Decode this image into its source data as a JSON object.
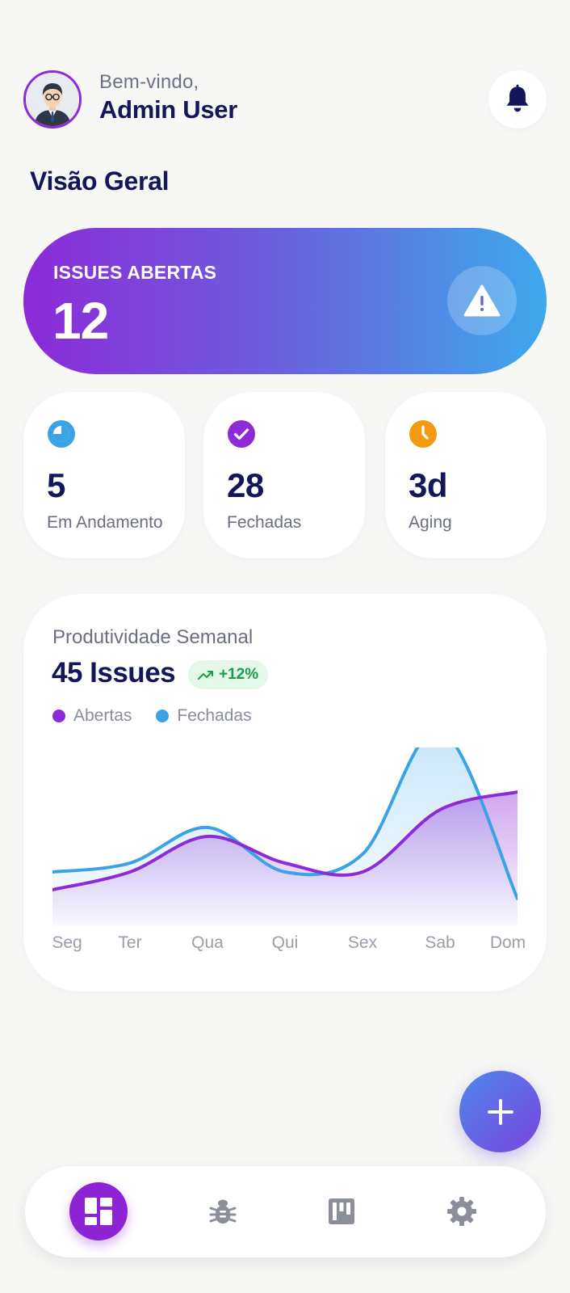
{
  "header": {
    "greeting": "Bem-vindo,",
    "user_name": "Admin User",
    "avatar_icon": "user-avatar",
    "notification_icon": "bell-icon"
  },
  "overview": {
    "title": "Visão Geral",
    "hero": {
      "label": "ISSUES ABERTAS",
      "value": "12",
      "icon": "warning-icon"
    },
    "stats": [
      {
        "value": "5",
        "label": "Em Andamento",
        "icon": "progress-icon",
        "color": "#3aa3e6"
      },
      {
        "value": "28",
        "label": "Fechadas",
        "icon": "check-circle-icon",
        "color": "#8e2bd9"
      },
      {
        "value": "3d",
        "label": "Aging",
        "icon": "clock-icon",
        "color": "#f39a12"
      }
    ]
  },
  "productivity": {
    "subtitle": "Produtividade Semanal",
    "total": "45 Issues",
    "trend": "+12%",
    "trend_icon": "trending-up-icon",
    "legend": [
      {
        "name": "Abertas",
        "color": "#8e2bd9"
      },
      {
        "name": "Fechadas",
        "color": "#3aa3e6"
      }
    ]
  },
  "chart_data": {
    "type": "area",
    "categories": [
      "Seg",
      "Ter",
      "Qua",
      "Qui",
      "Sex",
      "Sab",
      "Dom"
    ],
    "series": [
      {
        "name": "Abertas",
        "color": "#8e2bd9",
        "values": [
          4,
          6,
          10,
          7,
          6,
          13,
          15
        ]
      },
      {
        "name": "Fechadas",
        "color": "#3aa3e6",
        "values": [
          6,
          7,
          11,
          6,
          8,
          22,
          3
        ]
      }
    ],
    "ylim": [
      0,
      20
    ],
    "grid": false,
    "legend": "top-left"
  },
  "fab": {
    "icon": "plus-icon"
  },
  "nav": [
    {
      "icon": "dashboard-icon",
      "active": true
    },
    {
      "icon": "bug-icon",
      "active": false
    },
    {
      "icon": "board-icon",
      "active": false
    },
    {
      "icon": "gear-icon",
      "active": false
    }
  ]
}
